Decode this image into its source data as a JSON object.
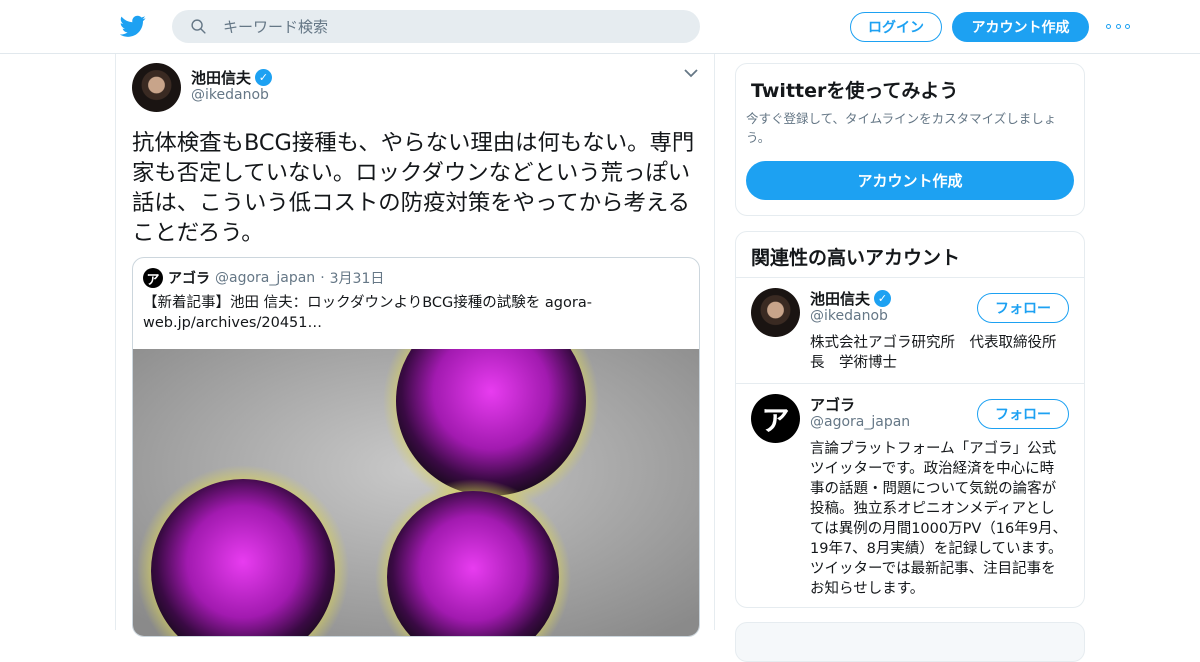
{
  "header": {
    "search_placeholder": "キーワード検索",
    "login_label": "ログイン",
    "signup_label": "アカウント作成",
    "brand_color": "#1da1f2"
  },
  "tweet": {
    "author_name": "池田信夫",
    "author_handle": "@ikedanob",
    "text": "抗体検査もBCG接種も、やらない理由は何もない。専門家も否定していない。ロックダウンなどという荒っぽい話は、こういう低コストの防疫対策をやってから考えることだろう。",
    "quote": {
      "avatar_glyph": "ア",
      "name": "アゴラ",
      "handle": "@agora_japan",
      "separator": "·",
      "date": "3月31日",
      "text": "【新着記事】池田 信夫：ロックダウンよりBCG接種の試験を agora-web.jp/archives/20451…"
    }
  },
  "signup_card": {
    "title": "Twitterを使ってみよう",
    "description": "今すぐ登録して、タイムラインをカスタマイズしましょう。",
    "button_label": "アカウント作成"
  },
  "related": {
    "title": "関連性の高いアカウント",
    "accounts": [
      {
        "name": "池田信夫",
        "handle": "@ikedanob",
        "verified": true,
        "bio": "株式会社アゴラ研究所　代表取締役所長　学術博士",
        "follow_label": "フォロー"
      },
      {
        "name": "アゴラ",
        "handle": "@agora_japan",
        "verified": false,
        "avatar_glyph": "ア",
        "bio": "言論プラットフォーム「アゴラ」公式ツイッターです。政治経済を中心に時事の話題・問題について気鋭の論客が投稿。独立系オピニオンメディアとしては異例の月間1000万PV（16年9月、19年7、8月実績）を記録しています。ツイッターでは最新記事、注目記事をお知らせします。",
        "follow_label": "フォロー"
      }
    ]
  }
}
